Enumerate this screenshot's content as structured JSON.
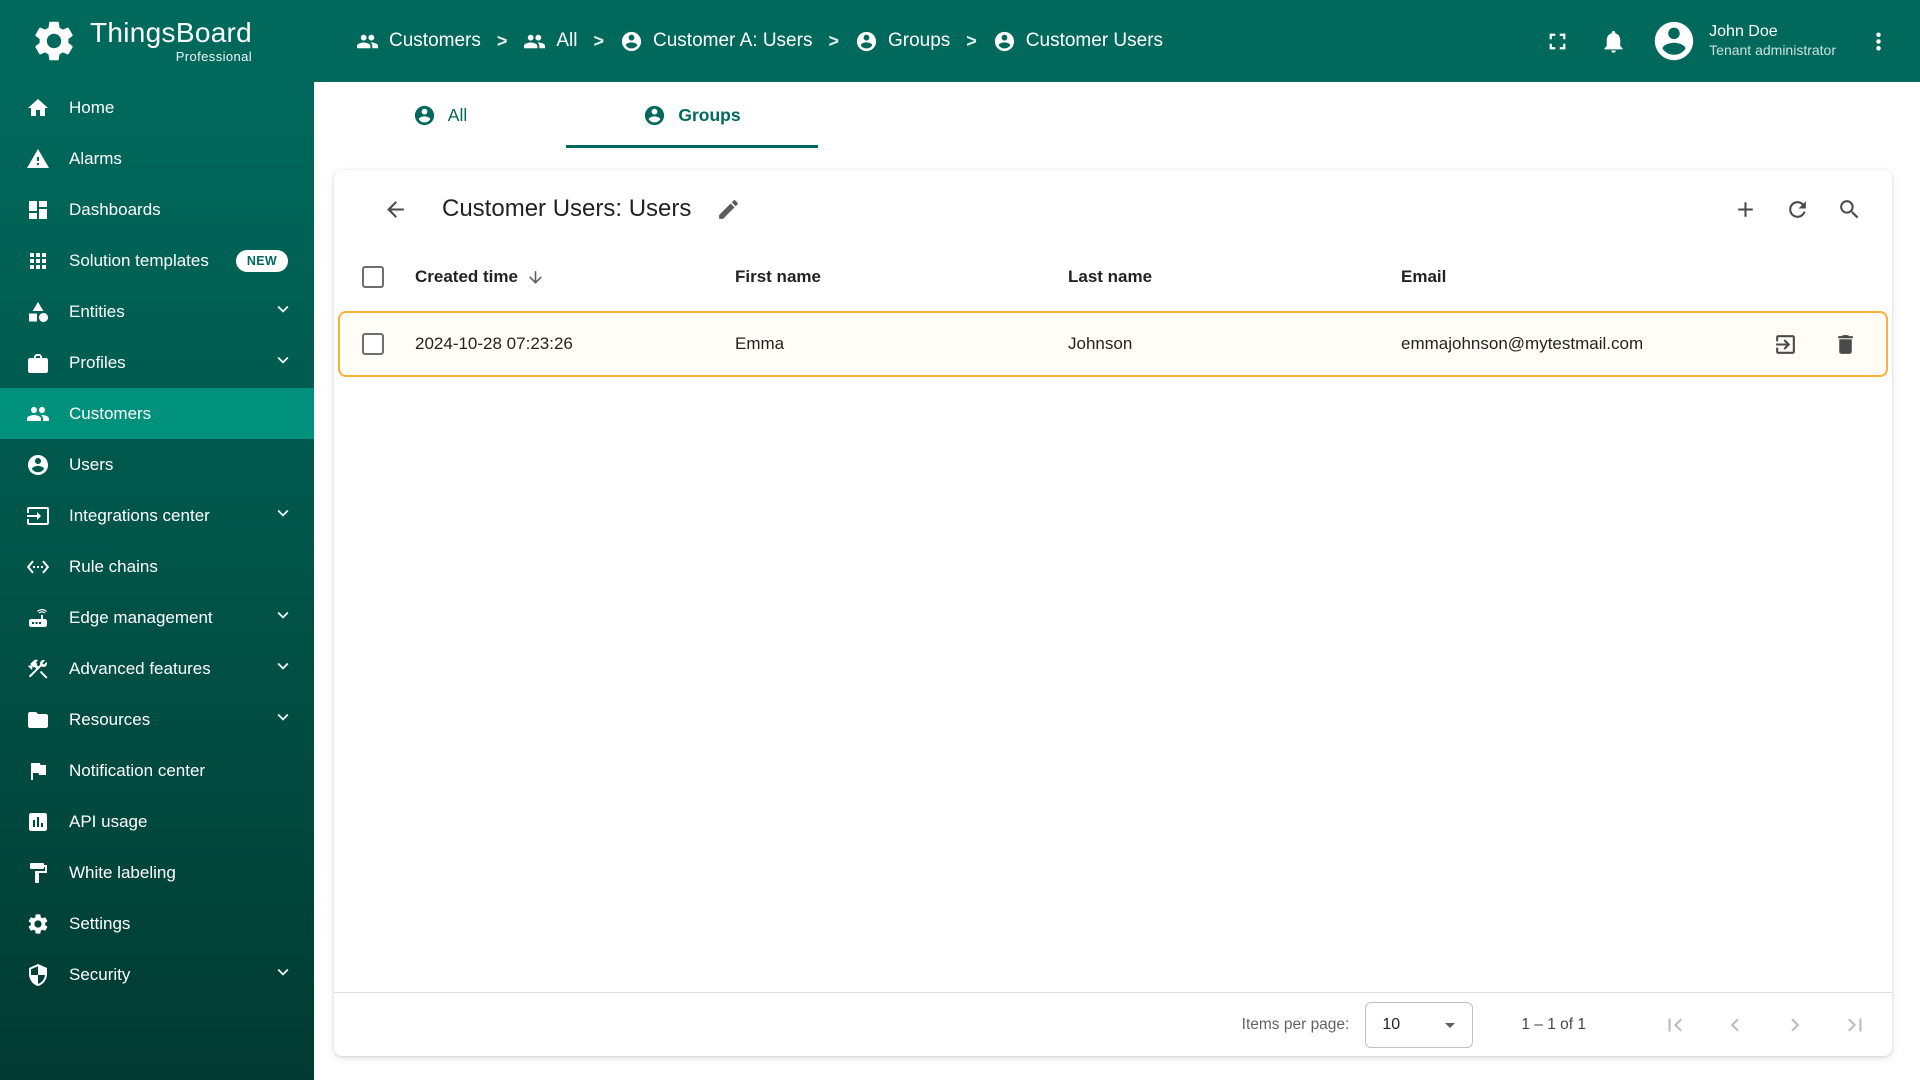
{
  "brand": {
    "name": "ThingsBoard",
    "subtitle": "Professional"
  },
  "breadcrumb": {
    "separator": ">",
    "items": [
      {
        "label": "Customers"
      },
      {
        "label": "All"
      },
      {
        "label": "Customer A: Users"
      },
      {
        "label": "Groups"
      },
      {
        "label": "Customer Users"
      }
    ]
  },
  "header_user": {
    "name": "John Doe",
    "role": "Tenant administrator"
  },
  "sidebar": {
    "items": [
      {
        "label": "Home"
      },
      {
        "label": "Alarms"
      },
      {
        "label": "Dashboards"
      },
      {
        "label": "Solution templates",
        "badge": "NEW"
      },
      {
        "label": "Entities"
      },
      {
        "label": "Profiles"
      },
      {
        "label": "Customers"
      },
      {
        "label": "Users"
      },
      {
        "label": "Integrations center"
      },
      {
        "label": "Rule chains"
      },
      {
        "label": "Edge management"
      },
      {
        "label": "Advanced features"
      },
      {
        "label": "Resources"
      },
      {
        "label": "Notification center"
      },
      {
        "label": "API usage"
      },
      {
        "label": "White labeling"
      },
      {
        "label": "Settings"
      },
      {
        "label": "Security"
      }
    ]
  },
  "tabs": [
    {
      "label": "All",
      "active": false
    },
    {
      "label": "Groups",
      "active": true
    }
  ],
  "panel": {
    "title": "Customer Users: Users"
  },
  "table": {
    "columns": {
      "created": "Created time",
      "first": "First name",
      "last": "Last name",
      "email": "Email"
    },
    "rows": [
      {
        "created": "2024-10-28 07:23:26",
        "first": "Emma",
        "last": "Johnson",
        "email": "emmajohnson@mytestmail.com"
      }
    ]
  },
  "pagination": {
    "items_per_page_label": "Items per page:",
    "items_per_page_value": "10",
    "range": "1 – 1 of 1"
  },
  "colors": {
    "primary": "#00695C",
    "sidebar_active": "#00917C",
    "row_highlight_border": "#FBB03B",
    "row_highlight_bg": "#FFFDF5"
  }
}
